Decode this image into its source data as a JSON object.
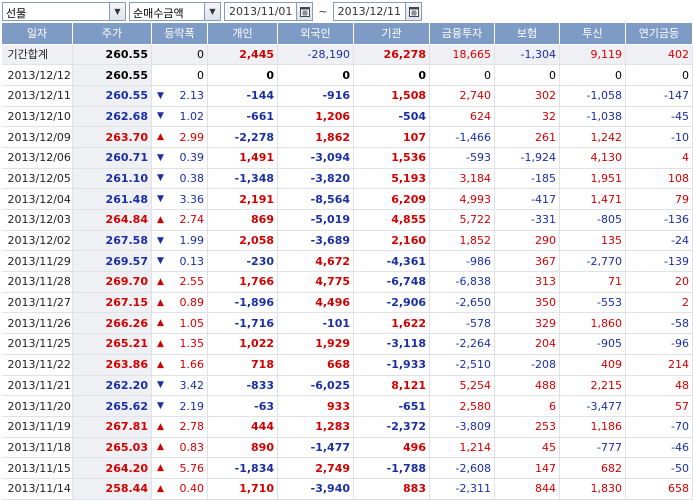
{
  "toolbar": {
    "category": "선물",
    "metric": "순매수금액",
    "date_from": "2013/11/01",
    "tilde": "~",
    "date_to": "2013/12/11"
  },
  "columns": [
    "일자",
    "주가",
    "등락폭",
    "개인",
    "외국인",
    "기관",
    "금융투자",
    "보험",
    "투신",
    "연기금등"
  ],
  "colors": {
    "up": "#d40000",
    "down": "#1a2fa6",
    "header_bg": "#7d9bc5"
  },
  "total_row": {
    "date": "기간합계",
    "price": "260.55",
    "change": "0",
    "individual": "2,445",
    "foreign": "-28,190",
    "institution": "26,278",
    "fin_invest": "18,665",
    "insurance": "-1,304",
    "trust": "9,119",
    "pension": "402"
  },
  "rows": [
    {
      "date": "2013/12/12",
      "price": "260.55",
      "dir": "none",
      "change": "0",
      "individual": "0",
      "foreign": "0",
      "institution": "0",
      "fin_invest": "0",
      "insurance": "0",
      "trust": "0",
      "pension": "0"
    },
    {
      "date": "2013/12/11",
      "price": "260.55",
      "dir": "down",
      "change": "2.13",
      "individual": "-144",
      "foreign": "-916",
      "institution": "1,508",
      "fin_invest": "2,740",
      "insurance": "302",
      "trust": "-1,058",
      "pension": "-147"
    },
    {
      "date": "2013/12/10",
      "price": "262.68",
      "dir": "down",
      "change": "1.02",
      "individual": "-661",
      "foreign": "1,206",
      "institution": "-504",
      "fin_invest": "624",
      "insurance": "32",
      "trust": "-1,038",
      "pension": "-45"
    },
    {
      "date": "2013/12/09",
      "price": "263.70",
      "dir": "up",
      "change": "2.99",
      "individual": "-2,278",
      "foreign": "1,862",
      "institution": "107",
      "fin_invest": "-1,466",
      "insurance": "261",
      "trust": "1,242",
      "pension": "-10"
    },
    {
      "date": "2013/12/06",
      "price": "260.71",
      "dir": "down",
      "change": "0.39",
      "individual": "1,491",
      "foreign": "-3,094",
      "institution": "1,536",
      "fin_invest": "-593",
      "insurance": "-1,924",
      "trust": "4,130",
      "pension": "4"
    },
    {
      "date": "2013/12/05",
      "price": "261.10",
      "dir": "down",
      "change": "0.38",
      "individual": "-1,348",
      "foreign": "-3,820",
      "institution": "5,193",
      "fin_invest": "3,184",
      "insurance": "-185",
      "trust": "1,951",
      "pension": "108"
    },
    {
      "date": "2013/12/04",
      "price": "261.48",
      "dir": "down",
      "change": "3.36",
      "individual": "2,191",
      "foreign": "-8,564",
      "institution": "6,209",
      "fin_invest": "4,993",
      "insurance": "-417",
      "trust": "1,471",
      "pension": "79"
    },
    {
      "date": "2013/12/03",
      "price": "264.84",
      "dir": "up",
      "change": "2.74",
      "individual": "869",
      "foreign": "-5,019",
      "institution": "4,855",
      "fin_invest": "5,722",
      "insurance": "-331",
      "trust": "-805",
      "pension": "-136"
    },
    {
      "date": "2013/12/02",
      "price": "267.58",
      "dir": "down",
      "change": "1.99",
      "individual": "2,058",
      "foreign": "-3,689",
      "institution": "2,160",
      "fin_invest": "1,852",
      "insurance": "290",
      "trust": "135",
      "pension": "-24"
    },
    {
      "date": "2013/11/29",
      "price": "269.57",
      "dir": "down",
      "change": "0.13",
      "individual": "-230",
      "foreign": "4,672",
      "institution": "-4,361",
      "fin_invest": "-986",
      "insurance": "367",
      "trust": "-2,770",
      "pension": "-139"
    },
    {
      "date": "2013/11/28",
      "price": "269.70",
      "dir": "up",
      "change": "2.55",
      "individual": "1,766",
      "foreign": "4,775",
      "institution": "-6,748",
      "fin_invest": "-6,838",
      "insurance": "313",
      "trust": "71",
      "pension": "20"
    },
    {
      "date": "2013/11/27",
      "price": "267.15",
      "dir": "up",
      "change": "0.89",
      "individual": "-1,896",
      "foreign": "4,496",
      "institution": "-2,906",
      "fin_invest": "-2,650",
      "insurance": "350",
      "trust": "-553",
      "pension": "2"
    },
    {
      "date": "2013/11/26",
      "price": "266.26",
      "dir": "up",
      "change": "1.05",
      "individual": "-1,716",
      "foreign": "-101",
      "institution": "1,622",
      "fin_invest": "-578",
      "insurance": "329",
      "trust": "1,860",
      "pension": "-58"
    },
    {
      "date": "2013/11/25",
      "price": "265.21",
      "dir": "up",
      "change": "1.35",
      "individual": "1,022",
      "foreign": "1,929",
      "institution": "-3,118",
      "fin_invest": "-2,264",
      "insurance": "204",
      "trust": "-905",
      "pension": "-96"
    },
    {
      "date": "2013/11/22",
      "price": "263.86",
      "dir": "up",
      "change": "1.66",
      "individual": "718",
      "foreign": "668",
      "institution": "-1,933",
      "fin_invest": "-2,510",
      "insurance": "-208",
      "trust": "409",
      "pension": "214"
    },
    {
      "date": "2013/11/21",
      "price": "262.20",
      "dir": "down",
      "change": "3.42",
      "individual": "-833",
      "foreign": "-6,025",
      "institution": "8,121",
      "fin_invest": "5,254",
      "insurance": "488",
      "trust": "2,215",
      "pension": "48"
    },
    {
      "date": "2013/11/20",
      "price": "265.62",
      "dir": "down",
      "change": "2.19",
      "individual": "-63",
      "foreign": "933",
      "institution": "-651",
      "fin_invest": "2,580",
      "insurance": "6",
      "trust": "-3,477",
      "pension": "57"
    },
    {
      "date": "2013/11/19",
      "price": "267.81",
      "dir": "up",
      "change": "2.78",
      "individual": "444",
      "foreign": "1,283",
      "institution": "-2,372",
      "fin_invest": "-3,809",
      "insurance": "253",
      "trust": "1,186",
      "pension": "-70"
    },
    {
      "date": "2013/11/18",
      "price": "265.03",
      "dir": "up",
      "change": "0.83",
      "individual": "890",
      "foreign": "-1,477",
      "institution": "496",
      "fin_invest": "1,214",
      "insurance": "45",
      "trust": "-777",
      "pension": "-46"
    },
    {
      "date": "2013/11/15",
      "price": "264.20",
      "dir": "up",
      "change": "5.76",
      "individual": "-1,834",
      "foreign": "2,749",
      "institution": "-1,788",
      "fin_invest": "-2,608",
      "insurance": "147",
      "trust": "682",
      "pension": "-50"
    },
    {
      "date": "2013/11/14",
      "price": "258.44",
      "dir": "up",
      "change": "0.40",
      "individual": "1,710",
      "foreign": "-3,940",
      "institution": "883",
      "fin_invest": "-2,311",
      "insurance": "844",
      "trust": "1,830",
      "pension": "658"
    }
  ]
}
